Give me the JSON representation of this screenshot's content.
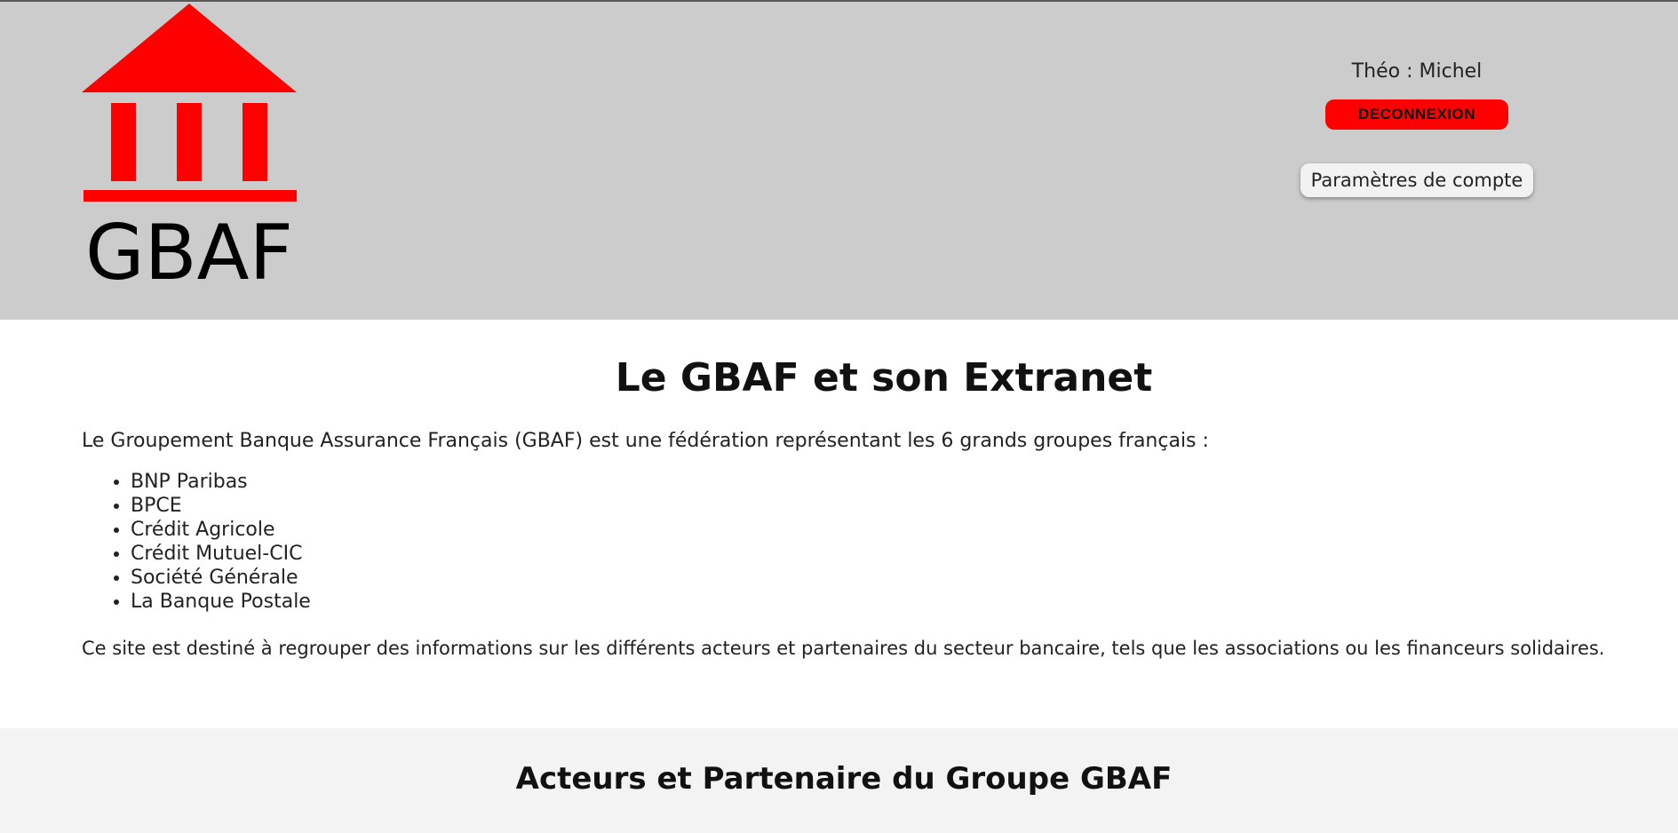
{
  "header": {
    "logo_text": "GBAF",
    "user": {
      "first_name": "Théo",
      "separator": " : ",
      "last_name": "Michel"
    },
    "logout_label": "DECONNEXION",
    "settings_label": "Paramètres de compte",
    "colors": {
      "background": "#cccccc",
      "logo_red": "#ff0000",
      "logout_button": "#ff0000"
    }
  },
  "main": {
    "title": "Le GBAF et son Extranet",
    "intro": "Le Groupement Banque Assurance Français (GBAF) est une fédération représentant les 6 grands groupes français :",
    "groups": [
      "BNP Paribas",
      "BPCE",
      "Crédit Agricole",
      "Crédit Mutuel-CIC",
      "Société Générale",
      "La Banque Postale"
    ],
    "outro": "Ce site est destiné à regrouper des informations sur les différents acteurs et partenaires du secteur bancaire, tels que les associations ou les financeurs solidaires."
  },
  "partners": {
    "title": "Acteurs et Partenaire du Groupe GBAF"
  }
}
